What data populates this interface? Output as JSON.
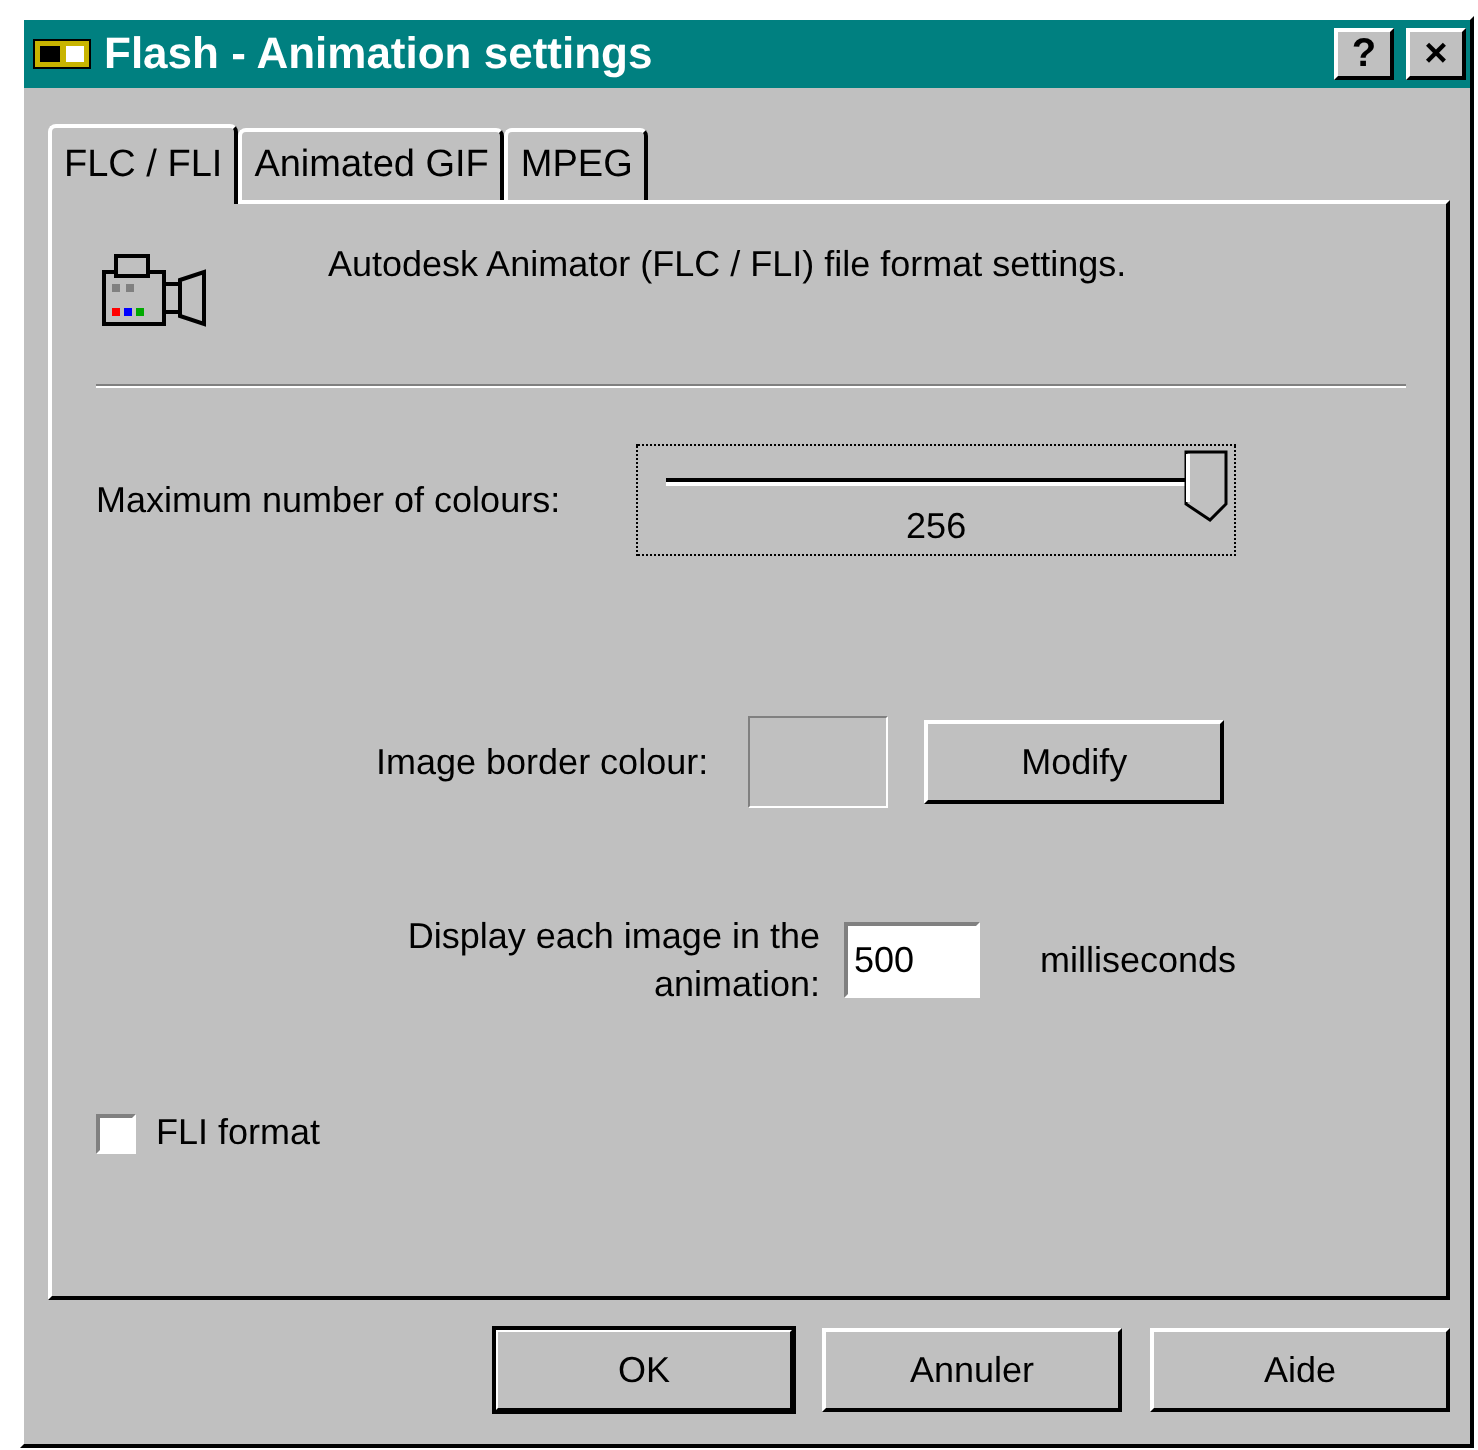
{
  "window": {
    "title": "Flash - Animation settings",
    "title_buttons": [
      "?",
      "×"
    ]
  },
  "tabs": [
    {
      "label": "FLC / FLI",
      "selected": true
    },
    {
      "label": "Animated GIF",
      "selected": false
    },
    {
      "label": "MPEG",
      "selected": false
    }
  ],
  "description": "Autodesk Animator (FLC / FLI) file format settings.",
  "colours": {
    "label": "Maximum number of colours:",
    "level": 1,
    "reading": "256"
  },
  "border": {
    "label": "Image border colour:",
    "button": "Modify"
  },
  "display": {
    "label": "Display each image in the animation:",
    "value": "500",
    "unit": "milliseconds"
  },
  "fli_format": {
    "label": "FLI format",
    "checked": false
  },
  "buttons": [
    {
      "label": "OK",
      "default": true
    },
    {
      "label": "Annuler",
      "default": false
    },
    {
      "label": "Aide",
      "default": false
    }
  ]
}
